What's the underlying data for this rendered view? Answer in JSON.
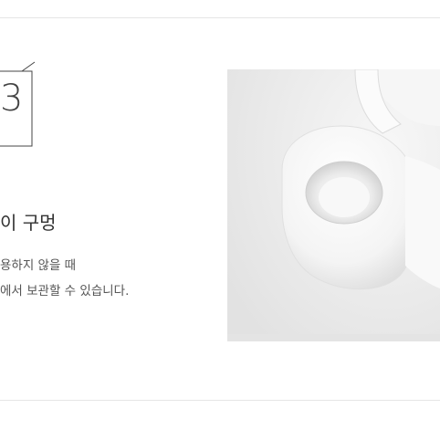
{
  "step": {
    "number": "3"
  },
  "feature": {
    "headline": "이 구멍",
    "description_lines": [
      "용하지 않을 때",
      "에서 보관할 수 있습니다."
    ]
  },
  "photo": {
    "subject": "white plastic ring hole product close-up",
    "background_color": "#ececec",
    "object_color": "#ffffff"
  }
}
